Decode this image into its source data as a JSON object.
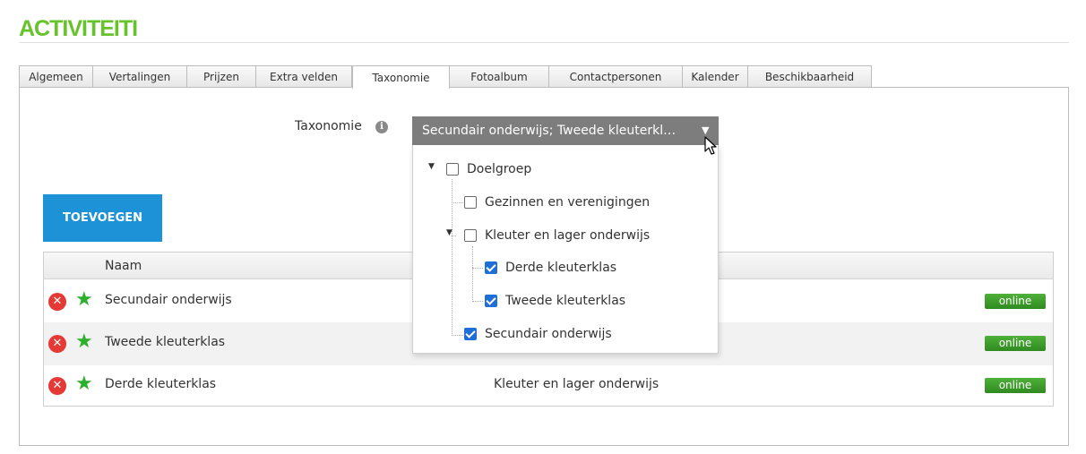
{
  "page": {
    "title": "ACTIVITEITI"
  },
  "tabs": [
    {
      "label": "Algemeen",
      "active": false
    },
    {
      "label": "Vertalingen",
      "active": false
    },
    {
      "label": "Prijzen",
      "active": false
    },
    {
      "label": "Extra velden",
      "active": false
    },
    {
      "label": "Taxonomie",
      "active": true
    },
    {
      "label": "Fotoalbum",
      "active": false
    },
    {
      "label": "Contactpersonen",
      "active": false
    },
    {
      "label": "Kalender",
      "active": false
    },
    {
      "label": "Beschikbaarheid",
      "active": false
    }
  ],
  "taxonomy": {
    "label": "Taxonomie",
    "info_icon": "info-icon",
    "select_value": "Secundair onderwijs; Tweede kleuterkl…",
    "arrow": "▼",
    "tree": [
      {
        "label": "Doelgroep",
        "checked": false,
        "expanded": true
      },
      {
        "label": "Gezinnen en verenigingen",
        "checked": false
      },
      {
        "label": "Kleuter en lager onderwijs",
        "checked": false,
        "expanded": true
      },
      {
        "label": "Derde kleuterklas",
        "checked": true
      },
      {
        "label": "Tweede kleuterklas",
        "checked": true
      },
      {
        "label": "Secundair onderwijs",
        "checked": true
      }
    ]
  },
  "add_button": {
    "label": "TOEVOEGEN"
  },
  "table": {
    "header_name": "Naam",
    "rows": [
      {
        "name": "Secundair onderwijs",
        "parent": "",
        "status": "online"
      },
      {
        "name": "Tweede kleuterklas",
        "parent": "",
        "status": "online"
      },
      {
        "name": "Derde kleuterklas",
        "parent": "Kleuter en lager onderwijs",
        "status": "online"
      }
    ]
  },
  "colors": {
    "title": "#67c32c",
    "button": "#1e92d6",
    "select": "#7d7d7d",
    "checkbox": "#1f6fd6",
    "badge": "#3b9c2a",
    "delete": "#e53935",
    "star": "#2bb02b"
  }
}
